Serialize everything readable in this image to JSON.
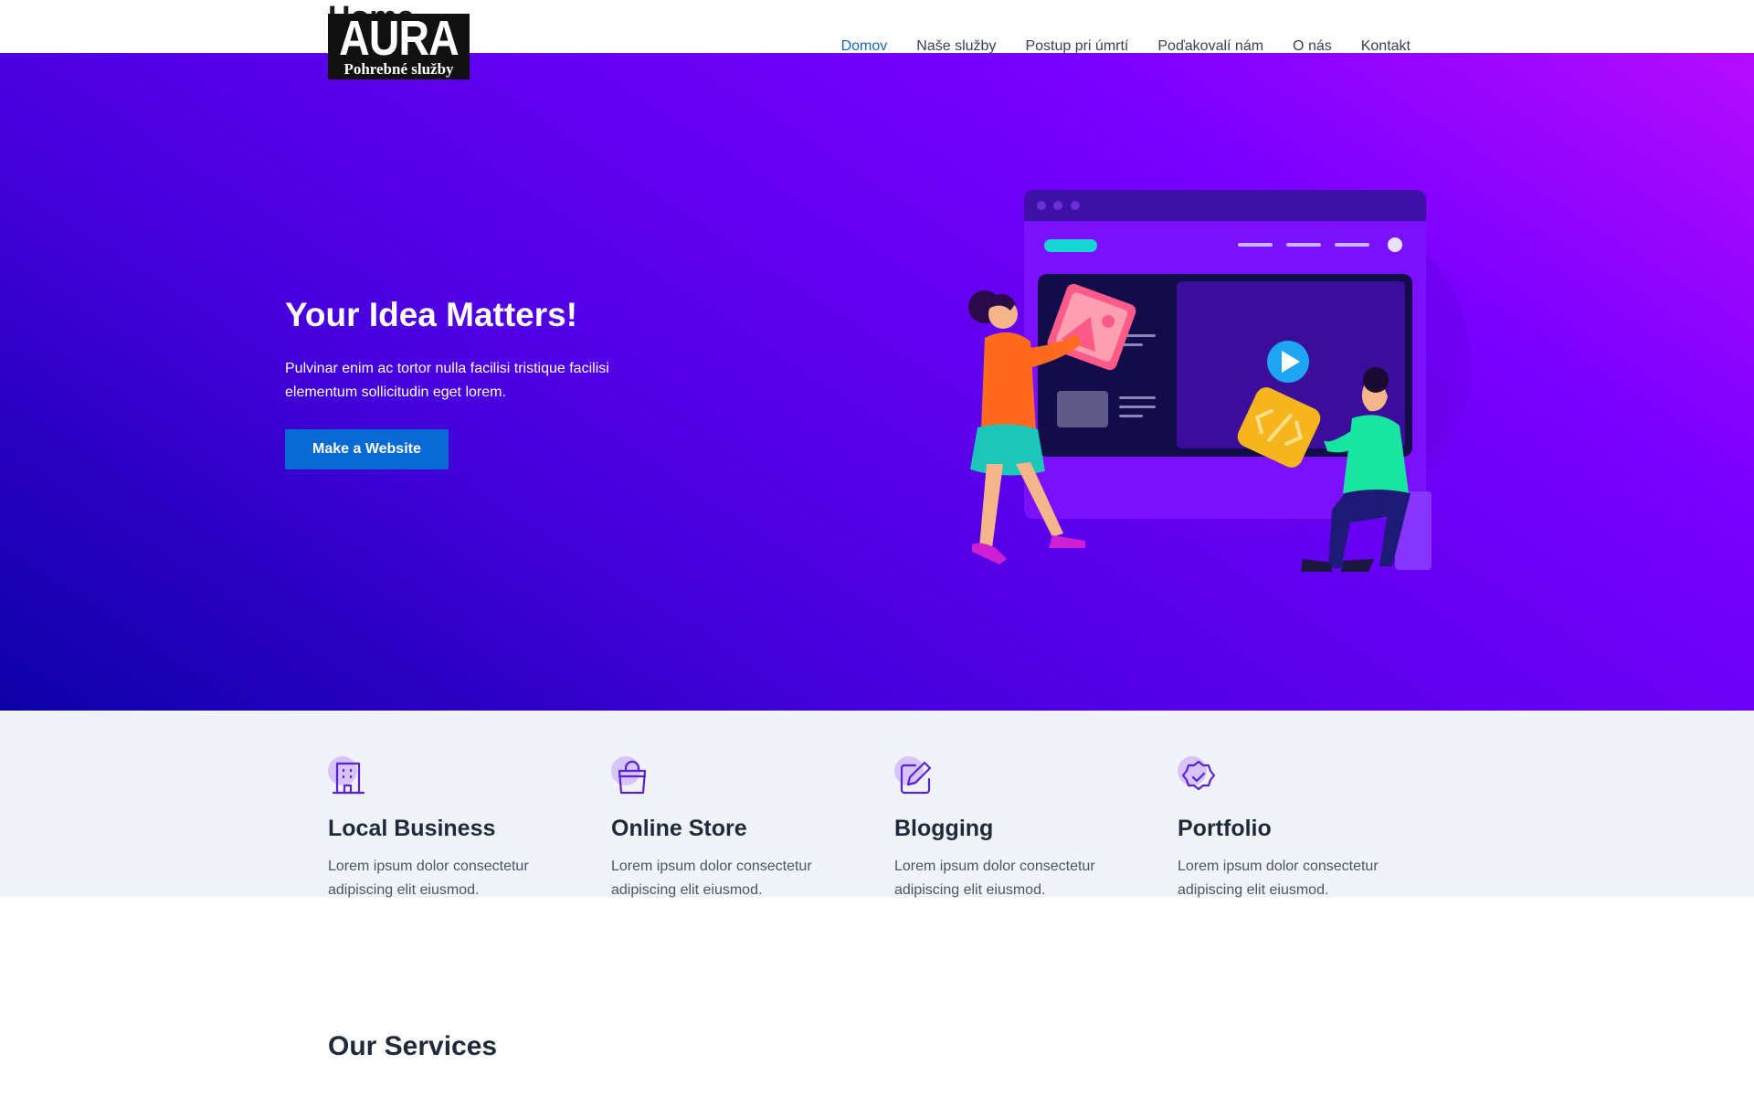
{
  "header": {
    "ghost_title": "Home",
    "logo": {
      "word": "AURA",
      "subtitle": "Pohrebné služby"
    },
    "nav": [
      {
        "label": "Domov",
        "active": true
      },
      {
        "label": "Naše služby",
        "active": false
      },
      {
        "label": "Postup pri úmrtí",
        "active": false
      },
      {
        "label": "Poďakovalí nám",
        "active": false
      },
      {
        "label": "O nás",
        "active": false
      },
      {
        "label": "Kontakt",
        "active": false
      }
    ]
  },
  "hero": {
    "title": "Your Idea Matters!",
    "description": "Pulvinar enim ac tortor nulla facilisi tristique facilisi elementum sollicitudin eget lorem.",
    "button_label": "Make a Website",
    "gradient_colors": [
      "#0d00a8",
      "#4a00e0",
      "#7a00ff",
      "#b50bff"
    ],
    "illustration": "people-building-website-illustration"
  },
  "features": [
    {
      "icon": "building-icon",
      "title": "Local Business",
      "text": "Lorem ipsum dolor consectetur adipiscing elit eiusmod."
    },
    {
      "icon": "shopping-bag-icon",
      "title": "Online Store",
      "text": "Lorem ipsum dolor consectetur adipiscing elit eiusmod."
    },
    {
      "icon": "edit-icon",
      "title": "Blogging",
      "text": "Lorem ipsum dolor consectetur adipiscing elit eiusmod."
    },
    {
      "icon": "badge-check-icon",
      "title": "Portfolio",
      "text": "Lorem ipsum dolor consectetur adipiscing elit eiusmod."
    }
  ],
  "services": {
    "title": "Our Services"
  },
  "colors": {
    "accent_nav": "#1565c0",
    "button": "#0a6ad4",
    "icon_stroke": "#5b21d6",
    "icon_blob": "#d7c4fb",
    "features_bg": "#f0f4f8"
  }
}
